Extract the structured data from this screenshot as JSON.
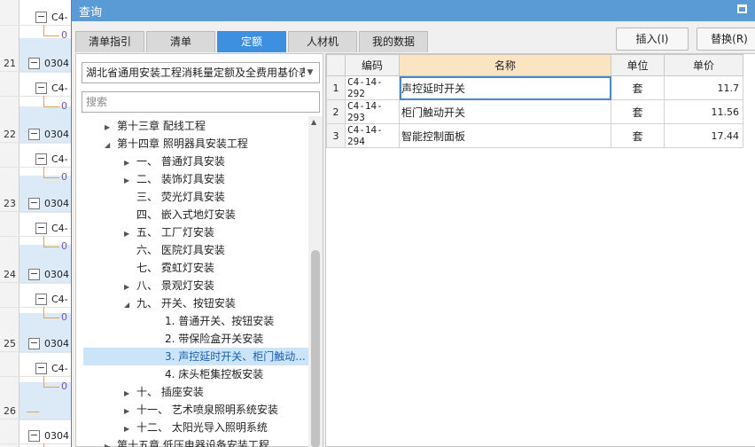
{
  "background": {
    "rows": [
      {
        "num": "",
        "code": "C4-",
        "band": false
      },
      {
        "num": "21",
        "code": "0304",
        "band": true
      },
      {
        "num": "",
        "code": "C4-",
        "band": false
      },
      {
        "num": "22",
        "code": "0304",
        "band": true
      },
      {
        "num": "",
        "code": "C4-",
        "band": false
      },
      {
        "num": "23",
        "code": "0304",
        "band": true
      },
      {
        "num": "",
        "code": "C4-",
        "band": false
      },
      {
        "num": "24",
        "code": "0304",
        "band": true
      },
      {
        "num": "",
        "code": "C4-",
        "band": false
      },
      {
        "num": "25",
        "code": "0304",
        "band": true
      },
      {
        "num": "",
        "code": "C4-",
        "band": false
      },
      {
        "num": "26",
        "code": "",
        "band": true
      },
      {
        "num": "",
        "code": "0304",
        "band": false
      }
    ],
    "zero_mark": "0",
    "minus_sign": "−"
  },
  "dialog": {
    "title": "查询",
    "tabs": [
      {
        "label": "清单指引",
        "active": false
      },
      {
        "label": "清单",
        "active": false
      },
      {
        "label": "定额",
        "active": true
      },
      {
        "label": "人材机",
        "active": false
      },
      {
        "label": "我的数据",
        "active": false
      }
    ],
    "buttons": {
      "insert": "插入(I)",
      "replace": "替换(R)"
    }
  },
  "left": {
    "library": "湖北省通用安装工程消耗量定额及全费用基价表",
    "search_placeholder": "搜索",
    "tree": [
      {
        "label": "第十三章 配线工程",
        "arrow": "right",
        "level": 1
      },
      {
        "label": "第十四章 照明器具安装工程",
        "arrow": "down",
        "level": 1
      },
      {
        "label": "一、 普通灯具安装",
        "arrow": "right",
        "level": 2
      },
      {
        "label": "二、 装饰灯具安装",
        "arrow": "right",
        "level": 2
      },
      {
        "label": "三、 荧光灯具安装",
        "arrow": "",
        "level": 2
      },
      {
        "label": "四、 嵌入式地灯安装",
        "arrow": "",
        "level": 2
      },
      {
        "label": "五、 工厂灯安装",
        "arrow": "right",
        "level": 2
      },
      {
        "label": "六、 医院灯具安装",
        "arrow": "",
        "level": 2
      },
      {
        "label": "七、 霓虹灯安装",
        "arrow": "",
        "level": 2
      },
      {
        "label": "八、 景观灯安装",
        "arrow": "right",
        "level": 2
      },
      {
        "label": "九、 开关、按钮安装",
        "arrow": "down",
        "level": 2
      },
      {
        "label": "1. 普通开关、按钮安装",
        "arrow": "",
        "level": 3
      },
      {
        "label": "2. 带保险盒开关安装",
        "arrow": "",
        "level": 3
      },
      {
        "label": "3. 声控延时开关、柜门触动...",
        "arrow": "",
        "level": 3,
        "selected": true
      },
      {
        "label": "4. 床头柜集控板安装",
        "arrow": "",
        "level": 3
      },
      {
        "label": "十、 插座安装",
        "arrow": "right",
        "level": 2
      },
      {
        "label": "十一、 艺术喷泉照明系统安装",
        "arrow": "right",
        "level": 2
      },
      {
        "label": "十二、 太阳光导入照明系统",
        "arrow": "right",
        "level": 2
      },
      {
        "label": "第十五章 低压电器设备安装工程",
        "arrow": "right",
        "level": 1
      }
    ]
  },
  "table": {
    "headers": {
      "code": "编码",
      "name": "名称",
      "unit": "单位",
      "price": "单价"
    },
    "rows": [
      {
        "no": "1",
        "code": "C4-14-292",
        "name": "声控延时开关",
        "unit": "套",
        "price": "11.7"
      },
      {
        "no": "2",
        "code": "C4-14-293",
        "name": "柜门触动开关",
        "unit": "套",
        "price": "11.56"
      },
      {
        "no": "3",
        "code": "C4-14-294",
        "name": "智能控制面板",
        "unit": "套",
        "price": "17.44"
      }
    ]
  }
}
